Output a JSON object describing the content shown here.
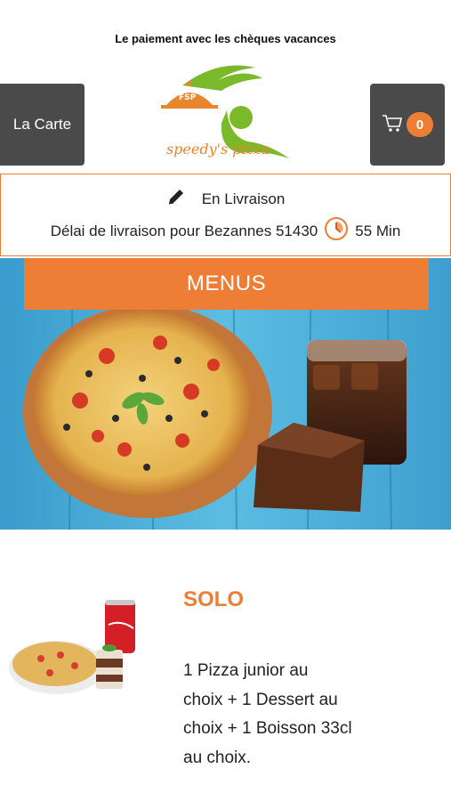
{
  "banner": {
    "text": "Le paiement avec les chèques vacances"
  },
  "header": {
    "carte_label": "La Carte",
    "cart_count": "0",
    "logo_text": "speedy's pizza"
  },
  "delivery": {
    "mode": "En Livraison",
    "info_prefix": "Délai de livraison pour Bezannes 51430",
    "time": "55 Min"
  },
  "hero": {
    "menus_label": "MENUS"
  },
  "menu_item": {
    "title": "SOLO",
    "description": "1 Pizza junior au choix  + 1 Dessert au choix  + 1 Boisson 33cl au choix."
  },
  "colors": {
    "accent": "#ee7d35",
    "dark_button": "#4a4a4a",
    "hero_wood": "#4fb3d9"
  },
  "icons": [
    "cart-icon",
    "pencil-icon",
    "clock-icon"
  ]
}
